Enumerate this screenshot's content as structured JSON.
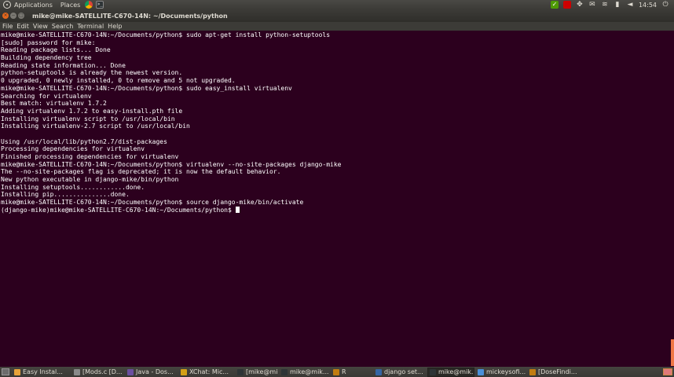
{
  "top_panel": {
    "applications": "Applications",
    "places": "Places",
    "launchers": [
      "chrome-icon",
      "terminal-icon"
    ],
    "clock": "14:54"
  },
  "window": {
    "title": "mike@mike-SATELLITE-C670-14N: ~/Documents/python"
  },
  "menubar": [
    "File",
    "Edit",
    "View",
    "Search",
    "Terminal",
    "Help"
  ],
  "terminal": {
    "lines": [
      "mike@mike-SATELLITE-C670-14N:~/Documents/python$ sudo apt-get install python-setuptools",
      "[sudo] password for mike:",
      "Reading package lists... Done",
      "Building dependency tree",
      "Reading state information... Done",
      "python-setuptools is already the newest version.",
      "0 upgraded, 0 newly installed, 0 to remove and 5 not upgraded.",
      "mike@mike-SATELLITE-C670-14N:~/Documents/python$ sudo easy_install virtualenv",
      "Searching for virtualenv",
      "Best match: virtualenv 1.7.2",
      "Adding virtualenv 1.7.2 to easy-install.pth file",
      "Installing virtualenv script to /usr/local/bin",
      "Installing virtualenv-2.7 script to /usr/local/bin",
      "",
      "Using /usr/local/lib/python2.7/dist-packages",
      "Processing dependencies for virtualenv",
      "Finished processing dependencies for virtualenv",
      "mike@mike-SATELLITE-C670-14N:~/Documents/python$ virtualenv --no-site-packages django-mike",
      "The --no-site-packages flag is deprecated; it is now the default behavior.",
      "New python executable in django-mike/bin/python",
      "Installing setuptools............done.",
      "Installing pip...............done.",
      "mike@mike-SATELLITE-C670-14N:~/Documents/python$ source django-mike/bin/activate",
      "(django-mike)mike@mike-SATELLITE-C670-14N:~/Documents/python$ "
    ]
  },
  "taskbar": [
    {
      "label": "Easy Instal...",
      "color": "#e8a33a"
    },
    {
      "label": "[Mods.c [D...",
      "color": "#8a8a8a"
    },
    {
      "label": "Java - Dos...",
      "color": "#6b4fa0"
    },
    {
      "label": "XChat: Mic...",
      "color": "#d4a017"
    },
    {
      "label": "[mike@mi...",
      "color": "#2e3436"
    },
    {
      "label": "mike@mik...",
      "color": "#2e3436"
    },
    {
      "label": "R",
      "color": "#c17d11"
    },
    {
      "label": "django set...",
      "color": "#3465a4"
    },
    {
      "label": "mike@mik...",
      "color": "#2e3436",
      "active": true
    },
    {
      "label": "mickeysofi...",
      "color": "#4a90d9"
    },
    {
      "label": "[DoseFindi...",
      "color": "#c17d11"
    }
  ],
  "colors": {
    "terminal_bg": "#2c001e",
    "panel_bg": "#3c3b37",
    "close_button": "#e2661c"
  }
}
